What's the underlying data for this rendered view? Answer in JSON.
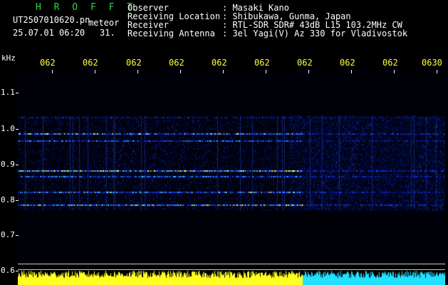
{
  "header": {
    "station_title": "H R O F F T",
    "filename": "UT2507010620.pn",
    "mode": "meteor",
    "datetime": "25.07.01 06:20",
    "count": "31.",
    "fields": [
      {
        "label": "Observer",
        "value": ": Masaki Kano"
      },
      {
        "label": "Receiving Location",
        "value": ": Shibukawa, Gunma, Japan"
      },
      {
        "label": "Receiver",
        "value": ": RTL-SDR SDR# 43dB L15 103.2MHz CW"
      },
      {
        "label": "Receiving Antenna",
        "value": ": 3el Yagi(V) Az 330 for Vladivostok"
      }
    ]
  },
  "time_axis": {
    "ticks": [
      "062",
      "062",
      "062",
      "062",
      "062",
      "062",
      "062",
      "062",
      "062",
      "0630"
    ]
  },
  "freq_axis": {
    "unit": "kHz",
    "ticks": [
      "1.1",
      "1.0",
      "0.9",
      "0.8",
      "0.7",
      "0.6"
    ]
  },
  "colors": {
    "header_text": "#ffffff",
    "title_green": "#2bd93a",
    "tick_yellow": "#ffff3a",
    "signal_core": "#ffff3a",
    "signal_mid": "#30c0ff",
    "signal_low": "#1a3cff",
    "noise": "#000f50",
    "level_yellow": "#ffff20",
    "level_cyan": "#20e0ff"
  },
  "spectrogram": {
    "bands_khz": [
      1.03,
      0.985,
      0.965,
      0.88,
      0.865,
      0.82,
      0.785
    ]
  }
}
